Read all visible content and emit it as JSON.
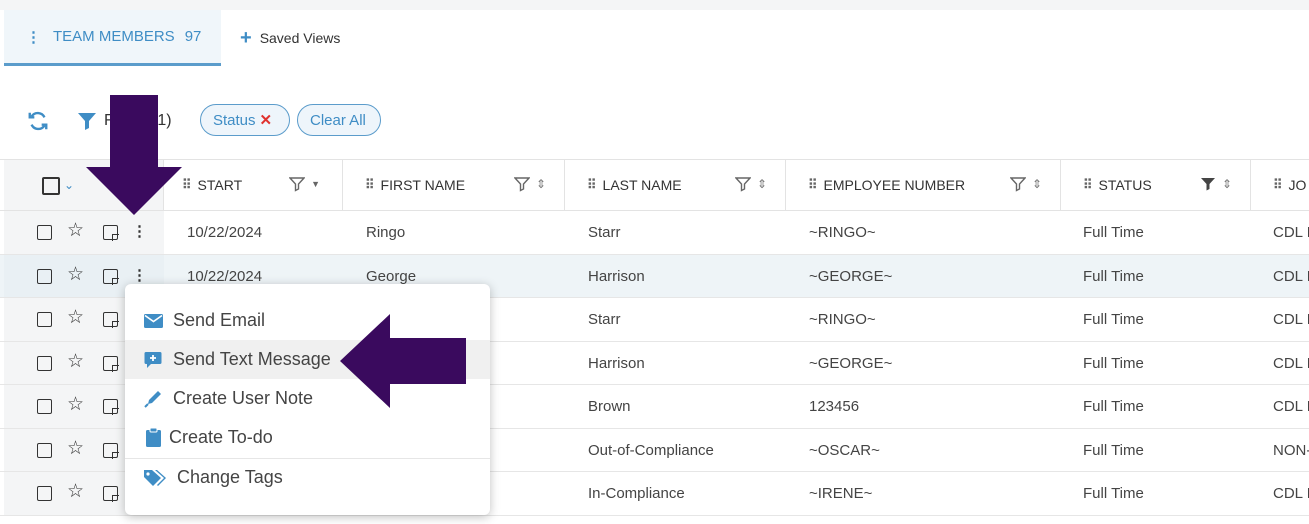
{
  "tabs": {
    "active": {
      "label": "TEAM MEMBERS",
      "count": "97"
    },
    "saved_views": {
      "label": "Saved Views"
    }
  },
  "toolbar": {
    "filters_label": "Filters (1)",
    "filters_visible": "F",
    "filters_count": "(1)",
    "chips": {
      "status": "Status",
      "clear_all": "Clear All"
    }
  },
  "columns": {
    "start": "START",
    "first_name": "FIRST NAME",
    "last_name": "LAST NAME",
    "employee_number": "EMPLOYEE NUMBER",
    "status": "STATUS",
    "job": "JO"
  },
  "rows": [
    {
      "start": "10/22/2024",
      "first": "Ringo",
      "last": "Starr",
      "emp": "~RINGO~",
      "status": "Full Time",
      "job": "CDL I"
    },
    {
      "start": "10/22/2024",
      "first": "George",
      "last": "Harrison",
      "emp": "~GEORGE~",
      "status": "Full Time",
      "job": "CDL I"
    },
    {
      "start": "",
      "first": "",
      "last": "Starr",
      "emp": "~RINGO~",
      "status": "Full Time",
      "job": "CDL I"
    },
    {
      "start": "",
      "first": "",
      "last": "Harrison",
      "emp": "~GEORGE~",
      "status": "Full Time",
      "job": "CDL I"
    },
    {
      "start": "",
      "first": "",
      "last": "Brown",
      "emp": "123456",
      "status": "Full Time",
      "job": "CDL I"
    },
    {
      "start": "",
      "first": "",
      "last": "Out-of-Compliance",
      "emp": "~OSCAR~",
      "status": "Full Time",
      "job": "NON-"
    },
    {
      "start": "",
      "first": "",
      "last": "In-Compliance",
      "emp": "~IRENE~",
      "status": "Full Time",
      "job": "CDL I"
    }
  ],
  "menu": {
    "items": [
      {
        "label": "Send Email",
        "icon": "envelope-icon"
      },
      {
        "label": "Send Text Message",
        "icon": "sms-icon"
      },
      {
        "label": "Create User Note",
        "icon": "pen-icon"
      },
      {
        "label": "Create To-do",
        "icon": "clipboard-icon"
      },
      {
        "label": "Change Tags",
        "icon": "tags-icon"
      }
    ]
  },
  "colors": {
    "accent": "#3f8dc5",
    "arrow": "#3a0a5e",
    "remove_x": "#e0322e"
  }
}
